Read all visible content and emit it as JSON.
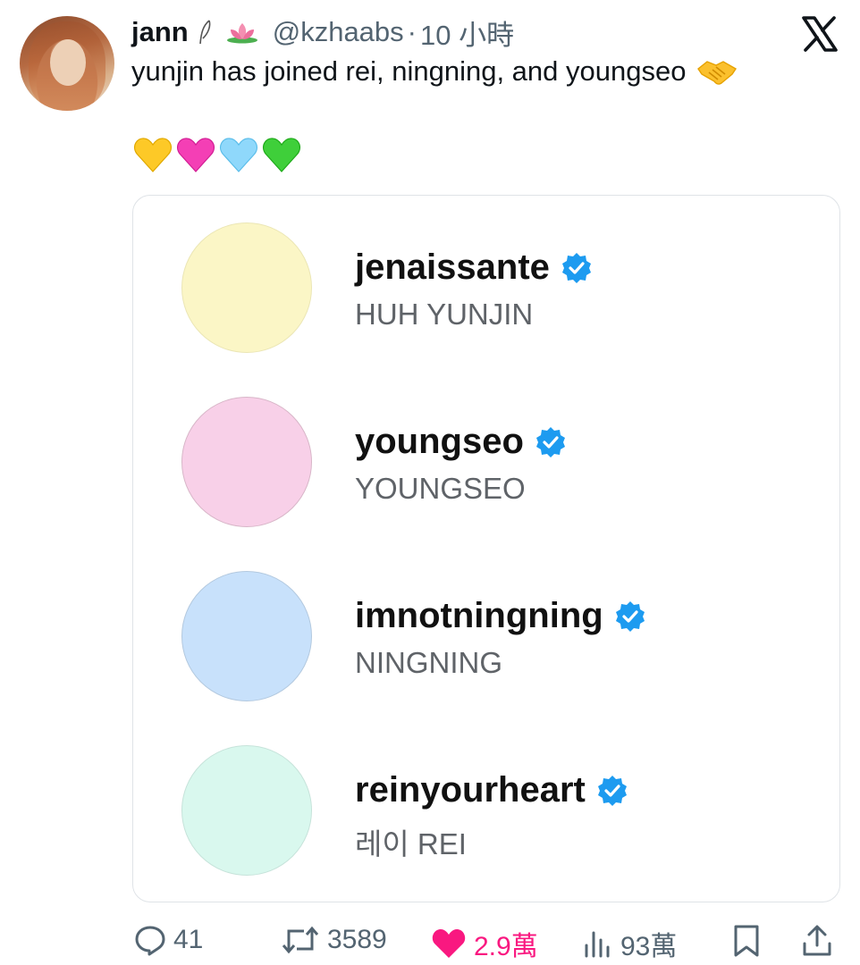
{
  "tweet": {
    "display_name": "jann",
    "handle": "@kzhaabs",
    "separator": "·",
    "time_ago": "10 小時",
    "text": "yunjin has joined rei, ningning, and youngseo",
    "heart_icons": [
      "yellow-heart-icon",
      "pink-heart-icon",
      "light-blue-heart-icon",
      "green-heart-icon"
    ]
  },
  "card": {
    "profiles": [
      {
        "username": "jenaissante",
        "full_name": "HUH YUNJIN",
        "avatar_color": "#fbf6c6",
        "border_color": "#ebe6b5"
      },
      {
        "username": "youngseo",
        "full_name": "YOUNGSEO",
        "avatar_color": "#f8d0e8",
        "border_color": "#d8b6c8"
      },
      {
        "username": "imnotningning",
        "full_name": "NINGNING",
        "avatar_color": "#c8e1fb",
        "border_color": "#b3c9df"
      },
      {
        "username": "reinyourheart",
        "full_name": "레이 REI",
        "avatar_color": "#d9f8ee",
        "border_color": "#c6e3da"
      }
    ]
  },
  "actions": {
    "replies": "41",
    "retweets": "3589",
    "likes": "2.9萬",
    "views": "93萬"
  },
  "colors": {
    "like": "#f91880",
    "verified": "#1d9bf0",
    "muted_text": "#536471"
  }
}
